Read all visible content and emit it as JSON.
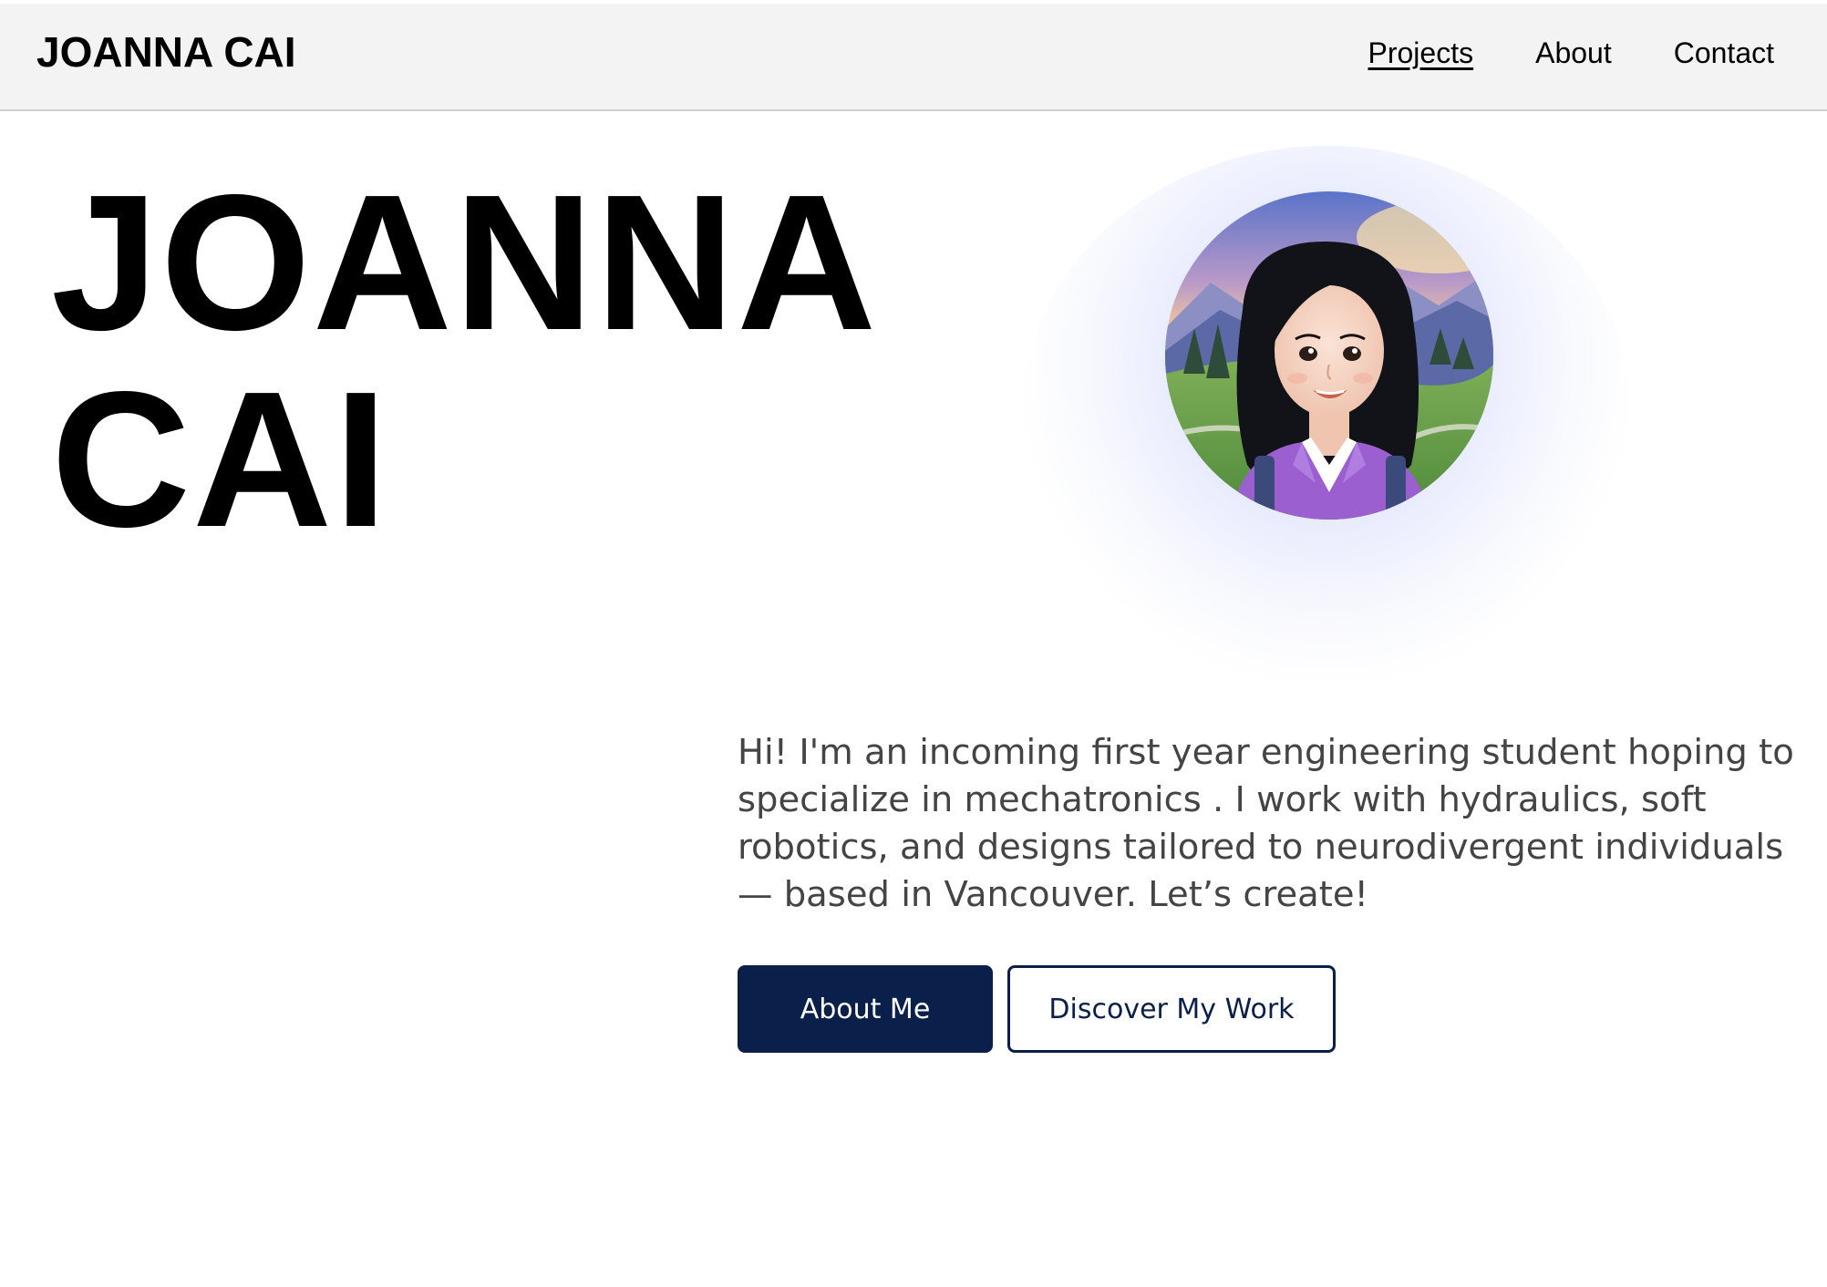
{
  "header": {
    "brand": "JOANNA CAI",
    "nav": [
      {
        "label": "Projects",
        "active": true
      },
      {
        "label": "About",
        "active": false
      },
      {
        "label": "Contact",
        "active": false
      }
    ]
  },
  "hero": {
    "title_line1": "JOANNA",
    "title_line2": "CAI",
    "avatar_alt": "illustrated portrait of a smiling woman with long black hair in a purple shirt with a mountain landscape background",
    "intro": "Hi! I'm an incoming first year engineering student hoping to specialize in mechatronics . I work with hydraulics, soft robotics, and designs tailored to neurodivergent individuals — based in Vancouver. Let’s create!",
    "buttons": {
      "primary": "About Me",
      "secondary": "Discover My Work"
    }
  },
  "colors": {
    "accent": "#0b1f4b",
    "header_bg": "#f3f3f3",
    "intro_text": "#444444"
  }
}
